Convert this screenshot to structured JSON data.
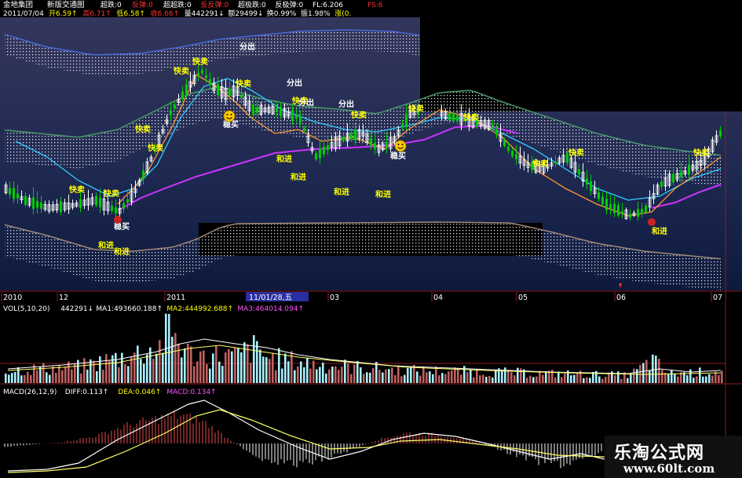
{
  "header": {
    "stock_name": "金地集团",
    "layout_name": "新版交通图",
    "row1": [
      {
        "text": "超跌:0",
        "color": "#ffffff"
      },
      {
        "text": "反弹:0",
        "color": "#ff3333"
      },
      {
        "text": "超超跌:0",
        "color": "#ffffff"
      },
      {
        "text": "反反弹:0",
        "color": "#ff3333"
      },
      {
        "text": "超极跌:0",
        "color": "#ffffff"
      },
      {
        "text": "反极弹:0",
        "color": "#ffffff"
      },
      {
        "text": "FL:6.206",
        "color": "#ffffff"
      },
      {
        "text": "FS:6",
        "color": "#ff3333"
      }
    ],
    "date": "2011/07/04",
    "row2": [
      {
        "text": "开6.59↑",
        "color": "#ffff00"
      },
      {
        "text": "高6.71↑",
        "color": "#ff3333"
      },
      {
        "text": "低6.58↑",
        "color": "#ffff00"
      },
      {
        "text": "收6.66↑",
        "color": "#ff3333"
      },
      {
        "text": "量442291↓",
        "color": "#ffffff"
      },
      {
        "text": "额29499↓",
        "color": "#ffffff"
      },
      {
        "text": "换0.99%",
        "color": "#ffffff"
      },
      {
        "text": "振1.98%",
        "color": "#ffffff"
      },
      {
        "text": "涨(0.",
        "color": "#ffff00"
      }
    ]
  },
  "signals": {
    "kuai_mai": "快卖",
    "he_jin": "和进",
    "fen_chu": "分出",
    "wen_mai": "稳买"
  },
  "time_axis": {
    "labels": [
      "2010",
      "12",
      "2011",
      "03",
      "04",
      "05",
      "06",
      "07"
    ],
    "cursor_label": "11/01/28,五"
  },
  "volume": {
    "header": [
      {
        "text": "VOL(5,10,20)",
        "color": "#ffffff"
      },
      {
        "text": "442291↓",
        "color": "#ffffff"
      },
      {
        "text": "MA1:493660.188↑",
        "color": "#ffffff"
      },
      {
        "text": "MA2:444992.688↑",
        "color": "#ffff00"
      },
      {
        "text": "MA3:464014.094↑",
        "color": "#ff55ff"
      }
    ]
  },
  "macd": {
    "header": [
      {
        "text": "MACD(26,12,9)",
        "color": "#ffffff"
      },
      {
        "text": "DIFF:0.113↑",
        "color": "#ffffff"
      },
      {
        "text": "DEA:0.046↑",
        "color": "#ffff00"
      },
      {
        "text": "MACD:0.134↑",
        "color": "#ff55ff"
      }
    ]
  },
  "watermark": {
    "name": "乐淘公式网",
    "url": "www.60lt.com"
  },
  "colors": {
    "up_candle": "#ffffff",
    "down_candle": "#00cc00",
    "panel_bg_top": "#30345a",
    "panel_bg_bottom": "#0c1a3c",
    "band_dots": "#ffffff",
    "ma_magenta": "#cc33ff",
    "ma_orange": "#ff9933",
    "ma_cyan": "#33ccff",
    "vol_up": "#c06060",
    "vol_down": "#a8f0ff"
  }
}
